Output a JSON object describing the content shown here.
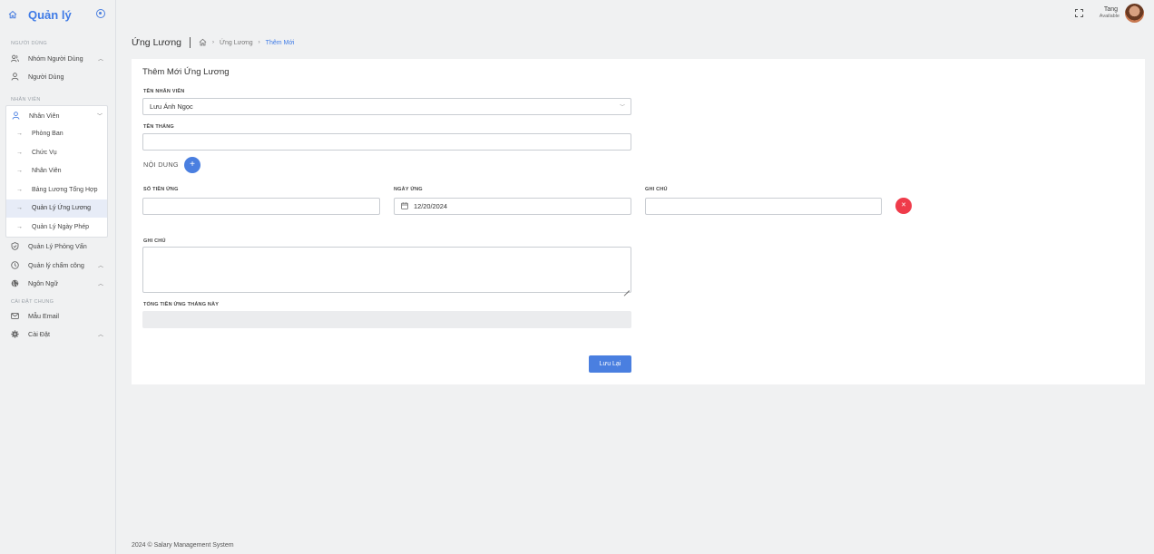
{
  "brand": {
    "title": "Quản lý"
  },
  "sidebar": {
    "section_users": "NGƯỜI DÙNG",
    "user_groups": "Nhóm Người Dùng",
    "users": "Người Dùng",
    "section_staff": "NHÂN VIÊN",
    "staff": "Nhân Viên",
    "sub": [
      "Phòng Ban",
      "Chức Vụ",
      "Nhân Viên",
      "Bảng Lương Tổng Hợp",
      "Quản Lý Ứng Lương",
      "Quản Lý Ngày Phép"
    ],
    "interviews": "Quản Lý Phỏng Vấn",
    "attendance": "Quản lý chấm công",
    "language": "Ngôn Ngữ",
    "section_settings": "CÀI ĐẶT CHUNG",
    "email_template": "Mẫu Email",
    "settings": "Cài Đặt"
  },
  "topbar": {
    "user_name": "Tang",
    "user_status": "Available"
  },
  "breadcrumb": {
    "page_title": "Ứng Lương",
    "link": "Ứng Lương",
    "current": "Thêm Mới"
  },
  "form": {
    "title": "Thêm Mới Ứng Lương",
    "employee_label": "TÊN NHÂN VIÊN",
    "employee_value": "Lưu Ánh Ngọc",
    "month_label": "TÊN THÁNG",
    "month_value": "",
    "content_label": "NỘI DUNG",
    "amount_label": "SỐ TIỀN ỨNG",
    "amount_value": "",
    "date_label": "NGÀY ỨNG",
    "date_value": "12/20/2024",
    "row_note_label": "GHI CHÚ",
    "row_note_value": "",
    "note_label": "GHI CHÚ",
    "total_label": "TỔNG TIỀN ỨNG THÁNG NÀY",
    "save_label": "Lưu Lại"
  },
  "footer": {
    "text": "2024 © Salary Management System"
  },
  "colors": {
    "accent": "#4a7fe0",
    "danger": "#ef3b4a"
  }
}
